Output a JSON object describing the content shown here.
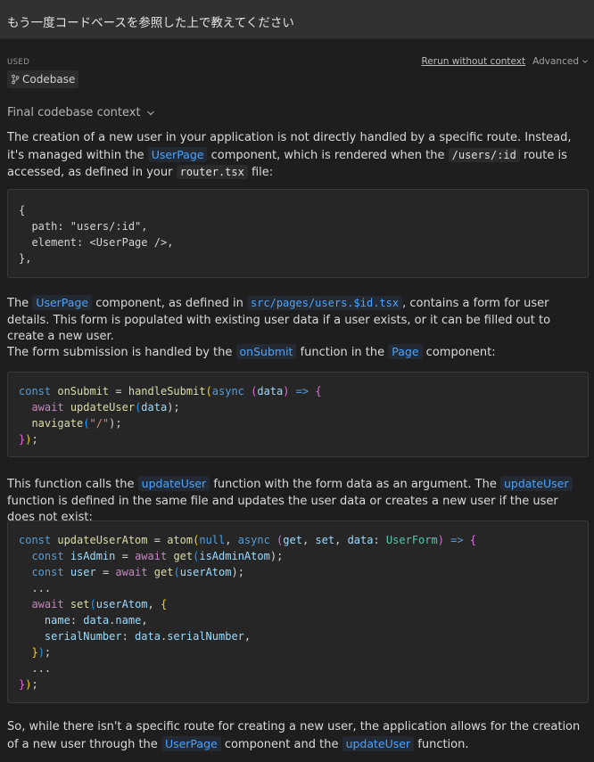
{
  "prompt": "もう一度コードベースを参照した上で教えてください",
  "used": {
    "label": "USED",
    "chip_label": "Codebase",
    "chip_icon": "branch-icon"
  },
  "actions": {
    "rerun": "Rerun without context",
    "advanced": "Advanced"
  },
  "context_toggle": "Final codebase context",
  "p1": {
    "t1": "The creation of a new user in your application is not directly handled by a specific route. Instead, it's managed within the ",
    "c1": "UserPage",
    "t2": " component, which is rendered when the ",
    "c2": "/users/:id",
    "t3": " route is accessed, as defined in your ",
    "c3": "router.tsx",
    "t4": " file:"
  },
  "code1": {
    "l1": "{",
    "l2a": "  path: ",
    "l2b": "\"users/:id\"",
    "l2c": ",",
    "l3a": "  element: ",
    "l3b": "<UserPage />",
    "l3c": ",",
    "l4": "},"
  },
  "p2": {
    "t1": "The ",
    "c1": "UserPage",
    "t2": " component, as defined in ",
    "c2": "src/pages/users.$id.tsx",
    "t3": ", contains a form for user details. This form is populated with existing user data if a user exists, or it can be filled out to create a new user."
  },
  "p3": {
    "t1": "The form submission is handled by the ",
    "c1": "onSubmit",
    "t2": " function in the ",
    "c2": "Page",
    "t3": " component:"
  },
  "code2": {
    "l1_const": "const",
    "l1_name": "onSubmit",
    "l1_eq": " = ",
    "l1_fn": "handleSubmit",
    "l1_open": "(",
    "l1_async": "async",
    "l1_p1": " (",
    "l1_data": "data",
    "l1_p2": ") ",
    "l1_arrow": "=>",
    "l1_brace": " {",
    "l2_await": "await",
    "l2_fn": "updateUser",
    "l2_a": "(",
    "l2_data": "data",
    "l2_b": ");",
    "l3_fn": "navigate",
    "l3_a": "(",
    "l3_str": "\"/\"",
    "l3_b": ");",
    "l4_close": "}",
    "l4_paren": ")",
    "l4_semi": ";"
  },
  "p4": {
    "t1": "This function calls the ",
    "c1": "updateUser",
    "t2": " function with the form data as an argument. The ",
    "c2": "updateUser",
    "t3": " function is defined in the same file and updates the user data or creates a new user if the user does not exist:"
  },
  "code3": {
    "l1_const": "const",
    "l1_name": "updateUserAtom",
    "l1_eq": " = ",
    "l1_fn": "atom",
    "l1_open": "(",
    "l1_null": "null",
    "l1_comma": ", ",
    "l1_async": "async",
    "l1_params_open": " (",
    "l1_get": "get",
    "l1_c2": ", ",
    "l1_set": "set",
    "l1_c3": ", ",
    "l1_data": "data",
    "l1_colon": ": ",
    "l1_type": "UserForm",
    "l1_params_close": ") ",
    "l1_arrow": "=>",
    "l1_brace": " {",
    "l2_const": "const",
    "l2_name": "isAdmin",
    "l2_eq": " = ",
    "l2_await": "await",
    "l2_fn": "get",
    "l2_a": "(",
    "l2_arg": "isAdminAtom",
    "l2_b": ");",
    "l3_const": "const",
    "l3_name": "user",
    "l3_eq": " = ",
    "l3_await": "await",
    "l3_fn": "get",
    "l3_a": "(",
    "l3_arg": "userAtom",
    "l3_b": ");",
    "l4": "...",
    "l5_await": "await",
    "l5_fn": "set",
    "l5_a": "(",
    "l5_arg": "userAtom",
    "l5_comma": ", ",
    "l5_brace": "{",
    "l6_key": "name",
    "l6_colon": ": ",
    "l6_obj": "data",
    "l6_dot": ".",
    "l6_prop": "name",
    "l6_comma": ",",
    "l7_key": "serialNumber",
    "l7_colon": ": ",
    "l7_obj": "data",
    "l7_dot": ".",
    "l7_prop": "serialNumber",
    "l7_comma": ",",
    "l8_brace": "}",
    "l8_paren": ")",
    "l8_semi": ";",
    "l9": "...",
    "l10_brace": "}",
    "l10_paren": ")",
    "l10_semi": ";"
  },
  "p5": {
    "t1": "So, while there isn't a specific route for creating a new user, the application allows for the creation of a new user through the ",
    "c1": "UserPage",
    "t2": " component and the ",
    "c2": "updateUser",
    "t3": " function."
  }
}
